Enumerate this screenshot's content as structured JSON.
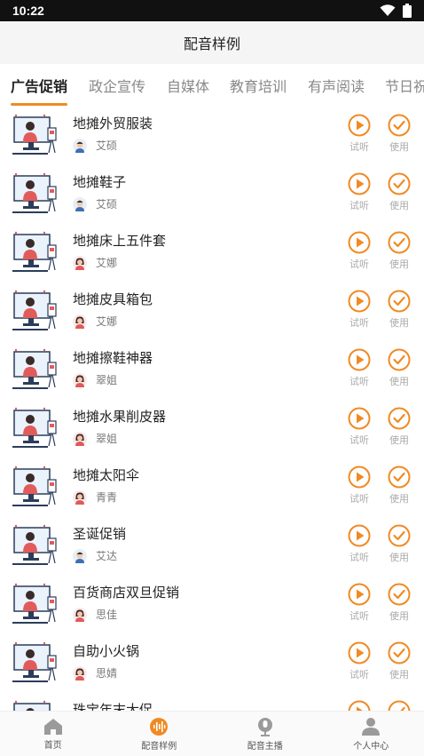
{
  "status": {
    "time": "10:22"
  },
  "header": {
    "title": "配音样例"
  },
  "tabs": [
    {
      "label": "广告促销"
    },
    {
      "label": "政企宣传"
    },
    {
      "label": "自媒体"
    },
    {
      "label": "教育培训"
    },
    {
      "label": "有声阅读"
    },
    {
      "label": "节日祝"
    }
  ],
  "actions": {
    "listen_label": "试听",
    "use_label": "使用"
  },
  "items": [
    {
      "title": "地摊外贸服装",
      "voice": "艾硕",
      "voice_gender": "male"
    },
    {
      "title": "地摊鞋子",
      "voice": "艾硕",
      "voice_gender": "male"
    },
    {
      "title": "地摊床上五件套",
      "voice": "艾娜",
      "voice_gender": "female"
    },
    {
      "title": "地摊皮具箱包",
      "voice": "艾娜",
      "voice_gender": "female"
    },
    {
      "title": "地摊擦鞋神器",
      "voice": "翠姐",
      "voice_gender": "female"
    },
    {
      "title": "地摊水果削皮器",
      "voice": "翠姐",
      "voice_gender": "female"
    },
    {
      "title": "地摊太阳伞",
      "voice": "青青",
      "voice_gender": "female"
    },
    {
      "title": "圣诞促销",
      "voice": "艾达",
      "voice_gender": "male"
    },
    {
      "title": "百货商店双旦促销",
      "voice": "思佳",
      "voice_gender": "female"
    },
    {
      "title": "自助小火锅",
      "voice": "思婧",
      "voice_gender": "female"
    },
    {
      "title": "珠宝年末大促",
      "voice": "",
      "voice_gender": "female"
    }
  ],
  "bottom_nav": [
    {
      "label": "首页",
      "icon": "home-icon"
    },
    {
      "label": "配音样例",
      "icon": "soundwave-icon"
    },
    {
      "label": "配音主播",
      "icon": "microphone-icon"
    },
    {
      "label": "个人中心",
      "icon": "person-icon"
    }
  ],
  "colors": {
    "accent": "#f08a24",
    "inactive_icon": "#9a9a9a"
  }
}
